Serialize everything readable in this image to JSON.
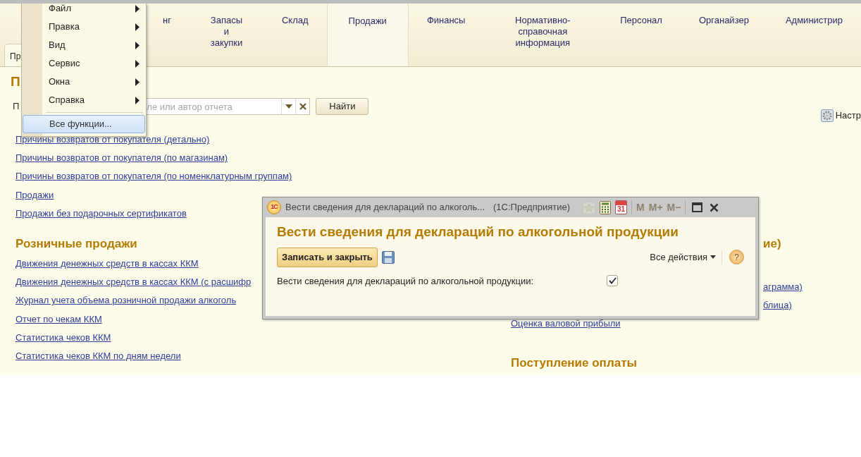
{
  "sections": [
    {
      "label": "нг",
      "selected": false
    },
    {
      "label": "Запасы и закупки",
      "selected": false
    },
    {
      "label": "Склад",
      "selected": false
    },
    {
      "label": "Продажи",
      "selected": true
    },
    {
      "label": "Финансы",
      "selected": false
    },
    {
      "label": "Нормативно-справочная информация",
      "selected": false
    },
    {
      "label": "Персонал",
      "selected": false
    },
    {
      "label": "Органайзер",
      "selected": false
    },
    {
      "label": "Администрир",
      "selected": false
    }
  ],
  "window_tabs": [
    {
      "label": "Пр",
      "selected": true
    }
  ],
  "page": {
    "title": "П",
    "search": {
      "label": "П",
      "placeholder": "ле или автор отчета",
      "button": "Найти"
    },
    "settings": "Настр",
    "top_links": [
      "Причины возвратов от покупателя (детально)",
      "Причины возвратов от покупателя (по магазинам)",
      "Причины возвратов от покупателя (по номенклатурным группам)",
      "Продажи",
      "Продажи без подарочных сертификатов"
    ],
    "left_column": [
      {
        "kind": "heading",
        "text": "Розничные продажи"
      },
      {
        "kind": "link",
        "text": "Движения денежных средств в кассах ККМ"
      },
      {
        "kind": "link",
        "text": "Движения денежных средств в кассах ККМ (с расшифр"
      },
      {
        "kind": "link",
        "text": "Журнал учета объема розничной продажи алкоголь"
      },
      {
        "kind": "link",
        "text": "Отчет по чекам ККМ"
      },
      {
        "kind": "link",
        "text": "Статистика чеков ККМ"
      },
      {
        "kind": "link",
        "text": "Статистика чеков ККМ по дням недели"
      }
    ],
    "right_column": [
      {
        "kind": "fragment-heading",
        "text": "ие)"
      },
      {
        "kind": "fragment-link",
        "text": "аграмма)"
      },
      {
        "kind": "fragment-link",
        "text": "блица)"
      },
      {
        "kind": "link",
        "text": "Оценка валовой прибыли"
      },
      {
        "kind": "heading",
        "text": "Поступление оплаты"
      }
    ]
  },
  "main_menu": [
    {
      "label": "Файл",
      "submenu": true,
      "selected": false
    },
    {
      "label": "Правка",
      "submenu": true,
      "selected": false
    },
    {
      "label": "Вид",
      "submenu": true,
      "selected": false
    },
    {
      "label": "Сервис",
      "submenu": true,
      "selected": false
    },
    {
      "label": "Окна",
      "submenu": true,
      "selected": false
    },
    {
      "label": "Справка",
      "submenu": true,
      "selected": false
    },
    {
      "label": "Все функции...",
      "submenu": false,
      "selected": true
    }
  ],
  "dialog": {
    "logo": "1С",
    "title": "Вести сведения для деклараций по алкоголь...",
    "app": "(1С:Предприятие)",
    "tools": [
      {
        "kind": "star",
        "disabled": true
      },
      {
        "kind": "calculator",
        "disabled": false
      },
      {
        "kind": "calendar",
        "text": "31",
        "disabled": false
      },
      {
        "kind": "text",
        "text": "M",
        "disabled": true
      },
      {
        "kind": "text",
        "text": "M+",
        "disabled": true
      },
      {
        "kind": "text",
        "text": "M−",
        "disabled": true
      }
    ],
    "heading": "Вести сведения для деклараций по алкогольной продукции",
    "save_close": "Записать и закрыть",
    "all_actions": "Все действия",
    "help": "?",
    "field_label": "Вести сведения для деклараций по алкогольной продукции:",
    "checked": true
  }
}
